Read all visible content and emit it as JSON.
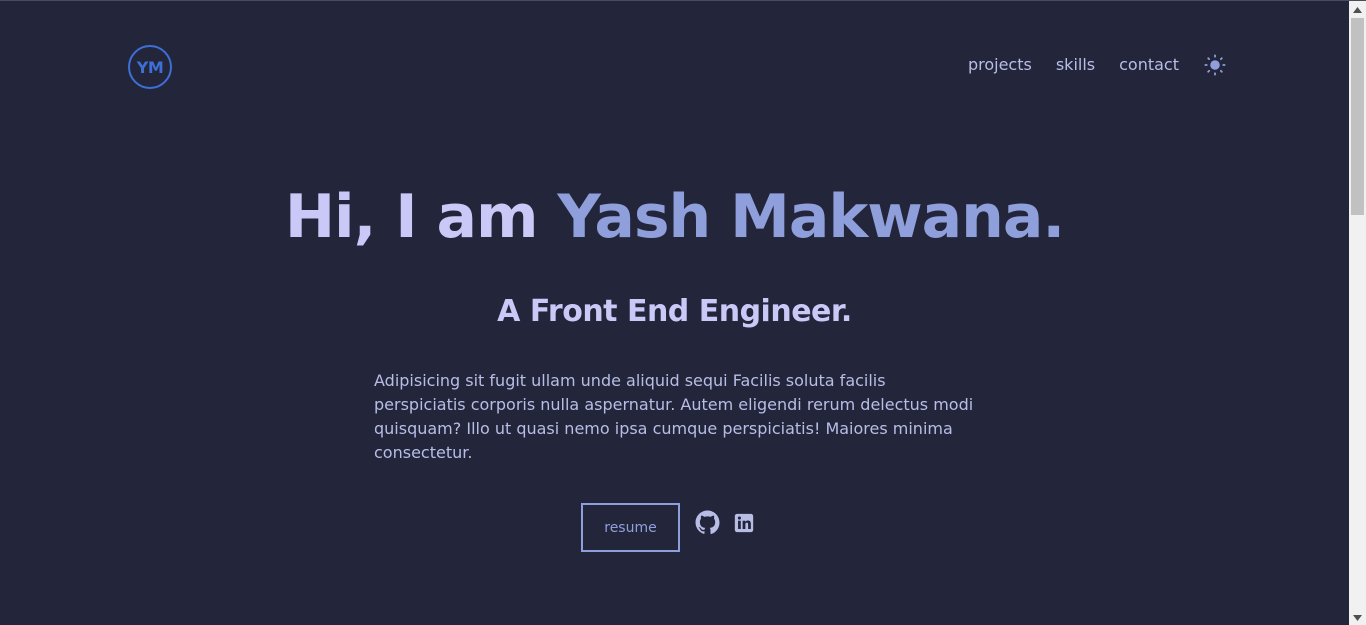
{
  "header": {
    "logo_text": "YM",
    "nav": [
      {
        "label": "projects"
      },
      {
        "label": "skills"
      },
      {
        "label": "contact"
      }
    ],
    "theme_toggle_icon": "sun-icon"
  },
  "hero": {
    "greeting": "Hi, I am ",
    "name": "Yash Makwana.",
    "subtitle": "A Front End Engineer.",
    "description": "Adipisicing sit fugit ullam unde aliquid sequi Facilis soluta facilis perspiciatis corporis nulla aspernatur. Autem eligendi rerum delectus modi quisquam? Illo ut quasi nemo ipsa cumque perspiciatis! Maiores minima consectetur.",
    "resume_label": "resume",
    "social_icons": [
      "github-icon",
      "linkedin-icon"
    ]
  },
  "colors": {
    "background": "#23263a",
    "logo_accent": "#3d6fd6",
    "heading": "#c9c8f7",
    "name_accent": "#8f9fdb",
    "body_text": "#b8bde6"
  }
}
